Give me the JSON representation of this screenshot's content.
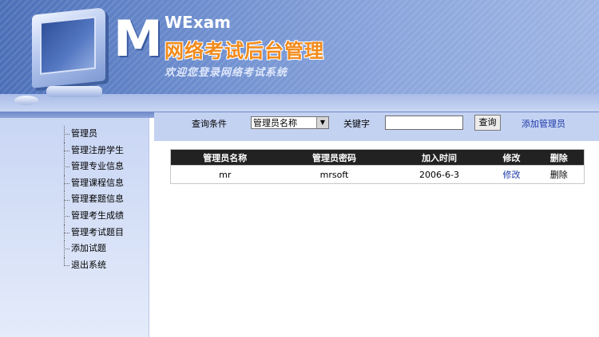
{
  "banner": {
    "logo_letter": "M",
    "brand": "WExam",
    "title": "网络考试后台管理",
    "subtitle": "欢迎您登录网络考试系统"
  },
  "sidebar": {
    "items": [
      {
        "label": "管理员"
      },
      {
        "label": "管理注册学生"
      },
      {
        "label": "管理专业信息"
      },
      {
        "label": "管理课程信息"
      },
      {
        "label": "管理套题信息"
      },
      {
        "label": "管理考生成绩"
      },
      {
        "label": "管理考试题目"
      },
      {
        "label": "添加试题"
      },
      {
        "label": "退出系统"
      }
    ]
  },
  "query": {
    "condition_label": "查询条件",
    "selected_option": "管理员名称",
    "keyword_label": "关键字",
    "keyword_value": "",
    "search_button": "查询",
    "add_link": "添加管理员"
  },
  "table": {
    "headers": [
      "管理员名称",
      "管理员密码",
      "加入时间",
      "修改",
      "删除"
    ],
    "rows": [
      {
        "name": "mr",
        "password": "mrsoft",
        "join_date": "2006-6-3",
        "edit": "修改",
        "delete": "删除"
      }
    ]
  },
  "colors": {
    "title_orange": "#f28a1a",
    "link_blue": "#1c3aa8",
    "header_black": "#222222",
    "sidebar_blue": "#c9d6f4"
  }
}
